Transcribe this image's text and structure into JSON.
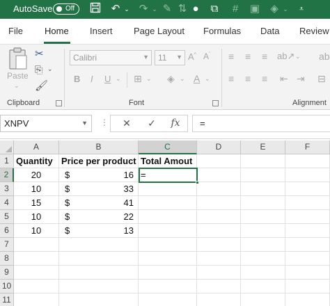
{
  "titlebar": {
    "autosave_label": "AutoSave",
    "autosave_state": "Off"
  },
  "tabs": [
    {
      "label": "File"
    },
    {
      "label": "Home",
      "active": true
    },
    {
      "label": "Insert"
    },
    {
      "label": "Page Layout"
    },
    {
      "label": "Formulas"
    },
    {
      "label": "Data"
    },
    {
      "label": "Review"
    }
  ],
  "ribbon": {
    "clipboard": {
      "paste_label": "Paste",
      "group_label": "Clipboard"
    },
    "font": {
      "font_name": "Calibri",
      "font_size": "11",
      "group_label": "Font"
    },
    "alignment": {
      "group_label": "Alignment"
    }
  },
  "formula_bar": {
    "name_box": "XNPV",
    "formula": "="
  },
  "grid": {
    "columns": [
      "A",
      "B",
      "C",
      "D",
      "E",
      "F"
    ],
    "rows": [
      "1",
      "2",
      "3",
      "4",
      "5",
      "6",
      "7",
      "8",
      "9",
      "10",
      "11"
    ],
    "headers": {
      "a": "Quantity",
      "b": "Price per product",
      "c": "Total Amout"
    },
    "data": [
      {
        "qty": "20",
        "cur": "$",
        "price": "16"
      },
      {
        "qty": "10",
        "cur": "$",
        "price": "33"
      },
      {
        "qty": "15",
        "cur": "$",
        "price": "41"
      },
      {
        "qty": "10",
        "cur": "$",
        "price": "22"
      },
      {
        "qty": "10",
        "cur": "$",
        "price": "13"
      }
    ],
    "active_cell_value": "=",
    "active_column": "C",
    "active_row": "2"
  },
  "colors": {
    "brand": "#217346",
    "ribbon_bg": "#f3f3f3"
  }
}
